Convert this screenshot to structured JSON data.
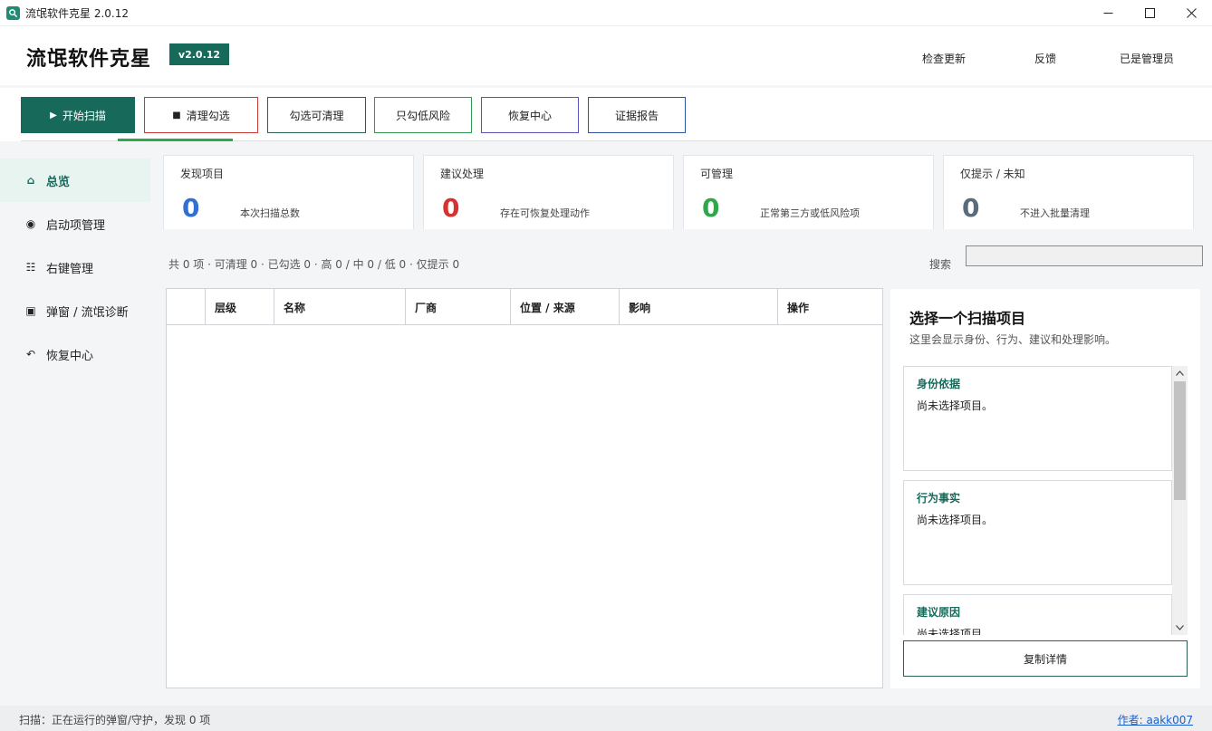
{
  "window": {
    "title": "流氓软件克星 2.0.12",
    "icon": "app-search-icon",
    "controls": [
      "minimize-icon",
      "maximize-icon",
      "close-icon"
    ]
  },
  "header": {
    "brand": "流氓软件克星",
    "version": "v2.0.12",
    "links": [
      "检查更新",
      "反馈",
      "已是管理员"
    ]
  },
  "toolbar": {
    "buttons": [
      {
        "label": "开始扫描",
        "icon": "play-icon",
        "color": "#17695a"
      },
      {
        "label": "清理勾选",
        "icon": "square-icon",
        "color": "#c83a3a"
      },
      {
        "label": "勾选可清理",
        "color": "#2a5f56"
      },
      {
        "label": "只勾低风险",
        "color": "#2f9a4f"
      },
      {
        "label": "恢复中心",
        "color": "#5a52b8"
      },
      {
        "label": "证据报告",
        "color": "#2f54a3"
      }
    ],
    "accent": "#2ea84a"
  },
  "sidebar": {
    "items": [
      {
        "label": "总览",
        "icon": "home-icon"
      },
      {
        "label": "启动项管理",
        "icon": "radio-icon"
      },
      {
        "label": "右键管理",
        "icon": "list-icon"
      },
      {
        "label": "弹窗 / 流氓诊断",
        "icon": "square-dot-icon"
      },
      {
        "label": "恢复中心",
        "icon": "undo-icon"
      }
    ]
  },
  "stats": [
    {
      "title": "发现项目",
      "value": "0",
      "desc": "本次扫描总数",
      "color": "#2f6fd6"
    },
    {
      "title": "建议处理",
      "value": "0",
      "desc": "存在可恢复处理动作",
      "color": "#d63232"
    },
    {
      "title": "可管理",
      "value": "0",
      "desc": "正常第三方或低风险项",
      "color": "#2ea84a"
    },
    {
      "title": "仅提示 / 未知",
      "value": "0",
      "desc": "不进入批量清理",
      "color": "#5b6b7d"
    }
  ],
  "filter": {
    "summary": "共 0 项 · 可清理 0 · 已勾选 0 · 高 0 / 中 0 / 低 0 · 仅提示 0",
    "search_label": "搜索",
    "search_value": ""
  },
  "table": {
    "columns": [
      "层级",
      "名称",
      "厂商",
      "位置 / 来源",
      "影响",
      "操作"
    ],
    "rows": []
  },
  "detail": {
    "title": "选择一个扫描项目",
    "subtitle": "这里会显示身份、行为、建议和处理影响。",
    "sections": [
      {
        "title": "身份依据",
        "body": "尚未选择项目。"
      },
      {
        "title": "行为事实",
        "body": "尚未选择项目。"
      },
      {
        "title": "建议原因",
        "body": "尚未选择项目。"
      }
    ],
    "copy_label": "复制详情"
  },
  "status": {
    "text": "扫描：正在运行的弹窗/守护，发现 0 项",
    "author": "作者: aakk007"
  }
}
